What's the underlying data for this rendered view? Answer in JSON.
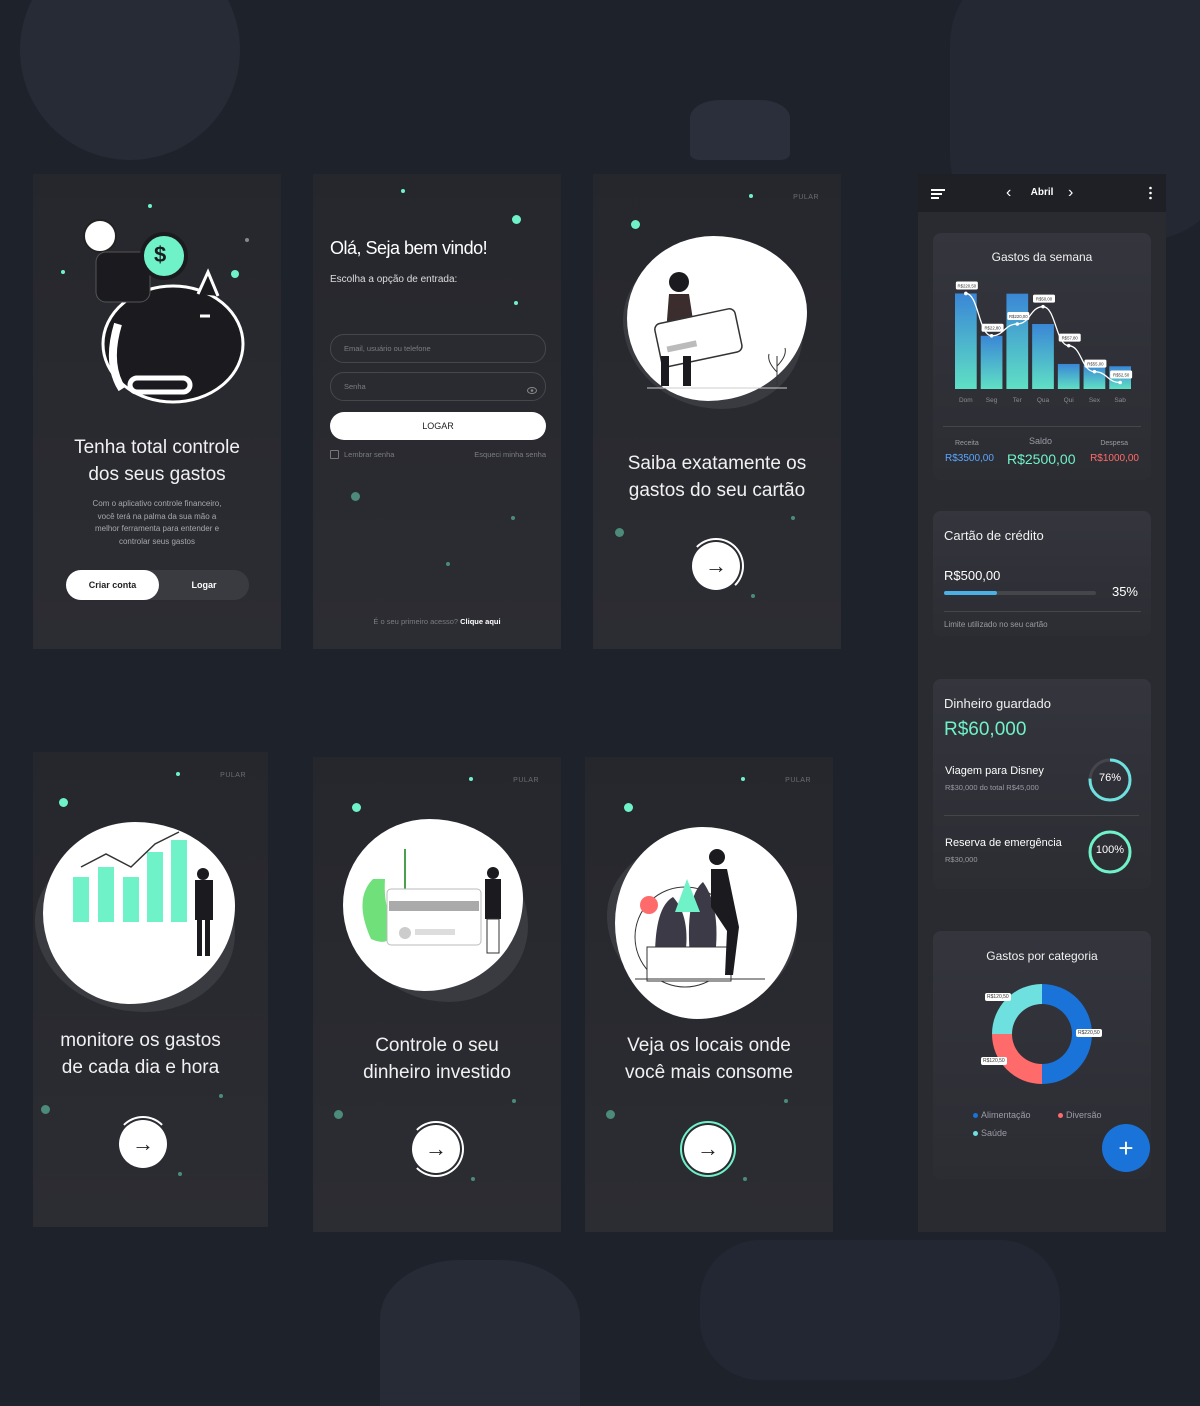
{
  "colors": {
    "accent": "#6ff2c8",
    "blue": "#1a73d9",
    "red": "#ff6b6b",
    "background": "#1e222b"
  },
  "s1": {
    "title_line1": "Tenha total controle",
    "title_line2": "dos seus gastos",
    "description": [
      "Com o aplicativo controle financeiro,",
      "você terá na palma da sua mão a",
      "melhor ferramenta para entender e",
      "controlar seus gastos"
    ],
    "btn_create": "Criar conta",
    "btn_login": "Logar",
    "coin_symbol": "$"
  },
  "s2": {
    "greeting": "Olá, Seja bem vindo!",
    "subtitle": "Escolha a opção de entrada:",
    "email_placeholder": "Email, usuário ou telefone",
    "password_placeholder": "Senha",
    "login_button": "LOGAR",
    "remember": "Lembrar senha",
    "forgot": "Esqueci minha senha",
    "first_access": "É o seu primeiro acesso?",
    "click_here": "Clique aqui"
  },
  "s3": {
    "skip": "PULAR",
    "title_line1": "Saiba exatamente os",
    "title_line2": "gastos do seu cartão"
  },
  "s4": {
    "skip": "PULAR",
    "title_line1": "monitore os gastos",
    "title_line2": "de cada dia e hora"
  },
  "s5": {
    "skip": "PULAR",
    "title_line1": "Controle o seu",
    "title_line2": "dinheiro investido"
  },
  "s6": {
    "skip": "PULAR",
    "title_line1": "Veja os locais onde",
    "title_line2": "você mais consome"
  },
  "dash": {
    "month": "Abril",
    "weekly": {
      "title": "Gastos da semana",
      "income_label": "Receita",
      "income": "R$3500,00",
      "balance_label": "Saldo",
      "balance": "R$2500,00",
      "expense_label": "Despesa",
      "expense": "R$1000,00"
    },
    "credit": {
      "title": "Cartão de crédito",
      "amount": "R$500,00",
      "percent": "35%",
      "fraction": 0.35,
      "note": "Limite utilizado no seu cartão"
    },
    "savings": {
      "title": "Dinheiro guardado",
      "total": "R$60,000",
      "goals": [
        {
          "name": "Viagem para Disney",
          "detail": "R$30,000 do total R$45,000",
          "percent": "76%",
          "fraction": 0.76
        },
        {
          "name": "Reserva de emergência",
          "detail": "R$30,000",
          "percent": "100%",
          "fraction": 1.0
        }
      ]
    },
    "category": {
      "title": "Gastos por categoria",
      "legend": [
        "Alimentação",
        "Diversão",
        "Saúde"
      ],
      "labels": [
        "R$120,50",
        "R$220,50",
        "R$120,50"
      ]
    }
  },
  "chart_data": {
    "type": "bar",
    "categories": [
      "Dom",
      "Seg",
      "Ter",
      "Qua",
      "Qui",
      "Sex",
      "Sab"
    ],
    "values": [
      220.5,
      122.8,
      220.0,
      150.0,
      57.8,
      55.0,
      52.5
    ],
    "value_labels": [
      "R$220,50",
      "R$22,80",
      "R$220,00",
      "R$50,00",
      "R$57,80",
      "R$55,00",
      "R$52,50"
    ],
    "line_values": [
      220.5,
      122.8,
      150.0,
      190.0,
      100.0,
      40.0,
      15.0
    ]
  },
  "donut": {
    "values": [
      0.5,
      0.25,
      0.25
    ],
    "colors": [
      "#1a73d9",
      "#ff6b6b",
      "#6ee0e0"
    ]
  }
}
